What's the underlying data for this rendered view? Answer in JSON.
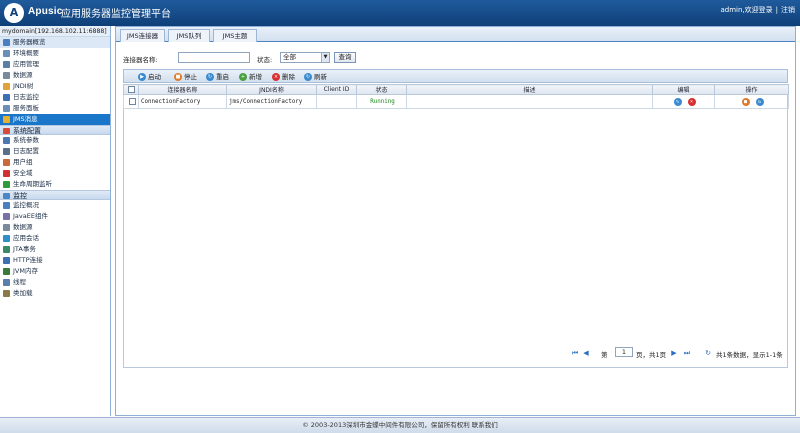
{
  "header": {
    "logo_letter": "A",
    "brand": "Apusic",
    "title": "应用服务器监控管理平台",
    "user": "admin,欢迎登录",
    "separator": "|",
    "logout": "注销"
  },
  "sidebar": {
    "domain": "mydomain[192.168.102.11:6888]",
    "groups": [
      {
        "items": [
          {
            "label": "服务器概览",
            "icon": "server-icon",
            "color": "#4a7fc1"
          },
          {
            "label": "环境概要",
            "icon": "doc-icon",
            "color": "#6c8fb8"
          },
          {
            "label": "应用管理",
            "icon": "app-icon",
            "color": "#5c7fa6"
          },
          {
            "label": "数据源",
            "icon": "database-icon",
            "color": "#7a8a9c"
          },
          {
            "label": "JNDI树",
            "icon": "tree-icon",
            "color": "#e0a23a"
          },
          {
            "label": "日志监控",
            "icon": "log-icon",
            "color": "#3d6fb3"
          },
          {
            "label": "服务面板",
            "icon": "panel-icon",
            "color": "#6c8fb8"
          },
          {
            "label": "JMS消息",
            "icon": "mail-icon",
            "color": "#e8b030"
          }
        ]
      },
      {
        "title": "系统配置",
        "items": [
          {
            "label": "系统参数",
            "icon": "params-icon",
            "color": "#4b77b3"
          },
          {
            "label": "日志配置",
            "icon": "log-config-icon",
            "color": "#5a6f88"
          },
          {
            "label": "用户组",
            "icon": "users-icon",
            "color": "#c96a3a"
          },
          {
            "label": "安全域",
            "icon": "security-icon",
            "color": "#d03030"
          },
          {
            "label": "生命周期监听",
            "icon": "lifecycle-icon",
            "color": "#2f9c3a"
          }
        ]
      },
      {
        "title": "监控",
        "items": [
          {
            "label": "监控概况",
            "icon": "chart-icon",
            "color": "#4a7fc1"
          },
          {
            "label": "JavaEE组件",
            "icon": "component-icon",
            "color": "#7a6fa8"
          },
          {
            "label": "数据源",
            "icon": "database-icon",
            "color": "#7a8a9c"
          },
          {
            "label": "应用会话",
            "icon": "session-icon",
            "color": "#2f8fc8"
          },
          {
            "label": "JTA事务",
            "icon": "jta-icon",
            "color": "#3a8a6a"
          },
          {
            "label": "HTTP连接",
            "icon": "http-icon",
            "color": "#3d6fb3"
          },
          {
            "label": "JVM内存",
            "icon": "memory-icon",
            "color": "#3a7a3a"
          },
          {
            "label": "线程",
            "icon": "thread-icon",
            "color": "#5a7fa8"
          },
          {
            "label": "类加载",
            "icon": "classload-icon",
            "color": "#8a7a4a"
          }
        ]
      }
    ]
  },
  "tabs": [
    {
      "label": "JMS连接器",
      "active": true
    },
    {
      "label": "JMS队列",
      "active": false
    },
    {
      "label": "JMS主题",
      "active": false
    }
  ],
  "filter": {
    "name_label": "连接器名称:",
    "name_value": "",
    "status_label": "状态:",
    "status_value": "全部",
    "query_button": "查询"
  },
  "toolbar": [
    {
      "label": "启动",
      "icon": "start-icon",
      "color": "#3a8ad0",
      "glyph": "▶"
    },
    {
      "label": "停止",
      "icon": "stop-icon",
      "color": "#e07a2a",
      "glyph": "■"
    },
    {
      "label": "重启",
      "icon": "restart-icon",
      "color": "#3a8ad0",
      "glyph": "↻"
    },
    {
      "label": "新增",
      "icon": "add-icon",
      "color": "#4aa040",
      "glyph": "+"
    },
    {
      "label": "删除",
      "icon": "delete-icon",
      "color": "#d83030",
      "glyph": "×"
    },
    {
      "label": "刷新",
      "icon": "refresh-icon",
      "color": "#3a8ad0",
      "glyph": "↻"
    }
  ],
  "table": {
    "headers": [
      "连接器名称",
      "JNDI名称",
      "Client ID",
      "状态",
      "描述",
      "编辑",
      "操作"
    ],
    "rows": [
      {
        "name": "ConnectionFactory",
        "jndi": "jms/ConnectionFactory",
        "client_id": "",
        "status": "Running",
        "description": ""
      }
    ]
  },
  "pager": {
    "page_prefix": "第",
    "page": "1",
    "page_suffix": "页，共1页",
    "summary": "共1条数据，显示1-1条"
  },
  "footer": "© 2003-2013深圳市金蝶中间件有限公司，保留所有权利 联系我们"
}
